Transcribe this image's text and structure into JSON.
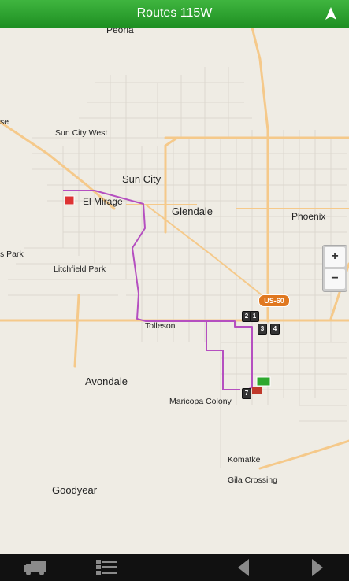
{
  "header": {
    "title": "Routes 115W",
    "nav_icon": "navigation-arrow-icon"
  },
  "map": {
    "places": {
      "peoria": "Peoria",
      "sun_city_west": "Sun City West",
      "sun_city": "Sun City",
      "el_mirage": "El Mirage",
      "glendale": "Glendale",
      "phoenix": "Phoenix",
      "litchfield_park": "Litchfield Park",
      "park_partial": "s Park",
      "se_partial": "se",
      "tolleson": "Tolleson",
      "avondale": "Avondale",
      "maricopa_colony": "Maricopa Colony",
      "komatke": "Komatke",
      "gila_crossing": "Gila Crossing",
      "goodyear": "Goodyear"
    },
    "highway_shield": "US-60",
    "stops": [
      "2",
      "1",
      "3",
      "4",
      "7"
    ],
    "zoom_in": "+",
    "zoom_out": "−",
    "route_color": "#b54fc0"
  },
  "toolbar": {
    "truck_icon": "truck-icon",
    "list_icon": "list-icon",
    "prev_icon": "previous-arrow-icon",
    "next_icon": "next-arrow-icon"
  }
}
